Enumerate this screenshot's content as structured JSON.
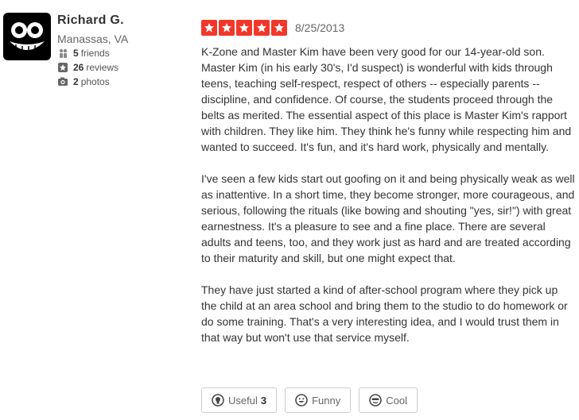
{
  "reviewer": {
    "name": "Richard G.",
    "location": "Manassas, VA",
    "friends_count": "5",
    "friends_label": "friends",
    "reviews_count": "26",
    "reviews_label": "reviews",
    "photos_count": "2",
    "photos_label": "photos"
  },
  "review": {
    "rating": 5,
    "date": "8/25/2013",
    "paragraphs": [
      "K-Zone and Master Kim have been very good for our 14-year-old son.  Master Kim (in his early 30's, I'd suspect) is wonderful with kids through teens, teaching self-respect, respect of others -- especially parents -- discipline, and confidence. Of course, the students proceed through the belts as merited. The essential aspect of this place is Master Kim's rapport with children. They like him. They think he's funny while respecting him and wanted to succeed. It's fun, and it's hard work, physically and mentally.",
      "I've seen a few kids start out goofing on it and being physically weak as well as inattentive.  In a short time, they become stronger, more courageous, and serious, following the rituals (like bowing and shouting \"yes, sir!\") with great earnestness. It's a pleasure to see and a fine place. There are several adults and teens, too, and they work just as hard and are treated according to their maturity and skill, but one might expect that.",
      "They have just started a kind of after-school program where they pick up the child at an area school and bring them to the studio to do homework or do some training. That's a very interesting idea, and I would trust them in that way but won't use that service myself."
    ]
  },
  "votes": {
    "useful_label": "Useful",
    "useful_count": "3",
    "funny_label": "Funny",
    "cool_label": "Cool"
  },
  "colors": {
    "star_red": "#f2372a",
    "avatar_bg": "#000000"
  },
  "icons": {
    "friends": "friends-icon",
    "reviews": "star-icon",
    "photos": "camera-icon",
    "useful": "lightbulb-icon",
    "funny": "smile-icon",
    "cool": "cool-face-icon"
  }
}
